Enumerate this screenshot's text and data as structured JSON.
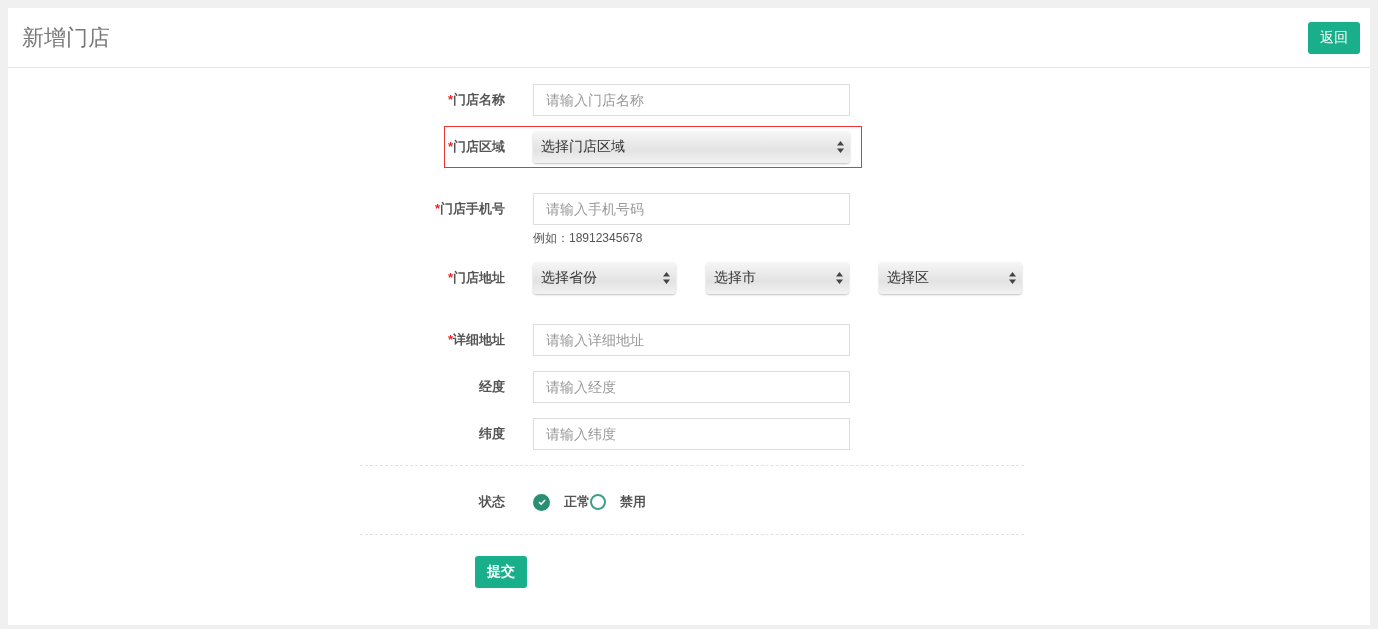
{
  "header": {
    "title": "新增门店",
    "back_button": "返回"
  },
  "fields": [
    {
      "kind": "input",
      "label": "门店名称",
      "mark": "*",
      "placeholder": "请输入门店名称",
      "highlighted": false
    },
    {
      "kind": "select",
      "label": "门店区域",
      "mark": "*",
      "options": [
        "选择门店区域"
      ],
      "highlighted": true
    },
    {
      "kind": "input",
      "label": "门店手机号",
      "mark": "*",
      "placeholder": "请输入手机号码",
      "hint": "例如：18912345678",
      "highlighted": false
    },
    {
      "kind": "select",
      "label": "门店地址",
      "mark": "*",
      "options": [
        "选择省份",
        "选择市",
        "选择区"
      ],
      "highlighted": false
    },
    {
      "kind": "input",
      "label": "详细地址",
      "mark": "*",
      "placeholder": "请输入详细地址",
      "highlighted": false
    },
    {
      "kind": "input",
      "label": "经度",
      "placeholder": "请输入经度",
      "highlighted": false
    },
    {
      "kind": "input",
      "label": "纬度",
      "placeholder": "请输入纬度",
      "highlighted": false
    }
  ],
  "status": {
    "label": "状态",
    "options": [
      {
        "label": "正常",
        "selected": true
      },
      {
        "label": "禁用",
        "selected": false
      }
    ]
  },
  "submit_button": "提交"
}
